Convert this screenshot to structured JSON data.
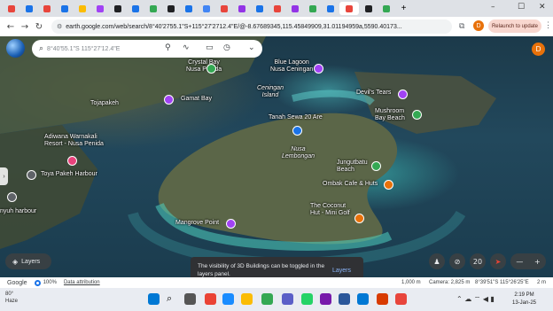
{
  "window": {
    "minimize": "–",
    "maximize": "☐",
    "close": "✕"
  },
  "tabs": {
    "colors": [
      "#e8453c",
      "#1a73e8",
      "#e8453c",
      "#1a73e8",
      "#fbbc04",
      "#a142f4",
      "#202124",
      "#1a73e8",
      "#34a853",
      "#202124",
      "#1a73e8",
      "#4285f4",
      "#e8453c",
      "#9334e6",
      "#1a73e8",
      "#e8453c",
      "#9334e6",
      "#34a853",
      "#1a73e8",
      "#e8453c",
      "#202124",
      "#34a853"
    ],
    "active_close": "✕",
    "new_tab": "+"
  },
  "address_bar": {
    "url": "earth.google.com/web/search/8°40'2755.1\"S+115°27'2712.4\"E/@-8.67689345,115.45849909,31.01194959a,5590.40173...",
    "relaunch_label": "Relaunch to update",
    "profile_initial": "D"
  },
  "earth": {
    "search_placeholder": "8°40'55.1\"S 115°27'12.4\"E",
    "avatar_initial": "D",
    "places": [
      {
        "name": "Crystal Bay\nNusa Penida",
        "icon_color": "#34a853"
      },
      {
        "name": "Blue Lagoon\nNusa Ceningan",
        "icon_color": "#a142f4"
      },
      {
        "name": "Ceningan\nIsland",
        "icon_color": ""
      },
      {
        "name": "Devil's Tears",
        "icon_color": "#a142f4"
      },
      {
        "name": "Tojapakeh",
        "icon_color": ""
      },
      {
        "name": "Gamat Bay",
        "icon_color": "#a142f4"
      },
      {
        "name": "Mushroom\nBay Beach",
        "icon_color": "#34a853"
      },
      {
        "name": "Tanah Sewa 20 Are",
        "icon_color": "#1a73e8"
      },
      {
        "name": "Nusa\nLembongan",
        "icon_color": ""
      },
      {
        "name": "Adiwana Warnakali\nResort - Nusa Penida",
        "icon_color": "#e8437c"
      },
      {
        "name": "Jungutbatu\nBeach",
        "icon_color": "#34a853"
      },
      {
        "name": "Toya Pakeh Harbour",
        "icon_color": "#5f6368"
      },
      {
        "name": "Ombak Cafe & Huts",
        "icon_color": "#e8710a"
      },
      {
        "name": "nyuh harbour",
        "icon_color": "#5f6368"
      },
      {
        "name": "The Coconut\nHut - Mini Golf",
        "icon_color": "#e8710a"
      },
      {
        "name": "Mangrove Point",
        "icon_color": "#a142f4"
      }
    ],
    "layers_label": "Layers",
    "toast": {
      "text": "The visibility of 3D Buildings can be toggled in the layers panel.",
      "action": "Layers"
    },
    "controls": {
      "zoom_label": "20",
      "zoom_in": "+",
      "zoom_out": "—"
    }
  },
  "status_bar": {
    "brand": "Google",
    "zoom": "100%",
    "attribution": "Data attribution",
    "scale": "1,000 m",
    "camera": "Camera: 2,825 m",
    "coords": "8°39'51\"S 115°26'25\"E",
    "elevation": "2 m"
  },
  "taskbar": {
    "weather_temp": "80°",
    "weather_label": "Haze",
    "time": "2:19 PM",
    "date": "13-Jan-25"
  }
}
